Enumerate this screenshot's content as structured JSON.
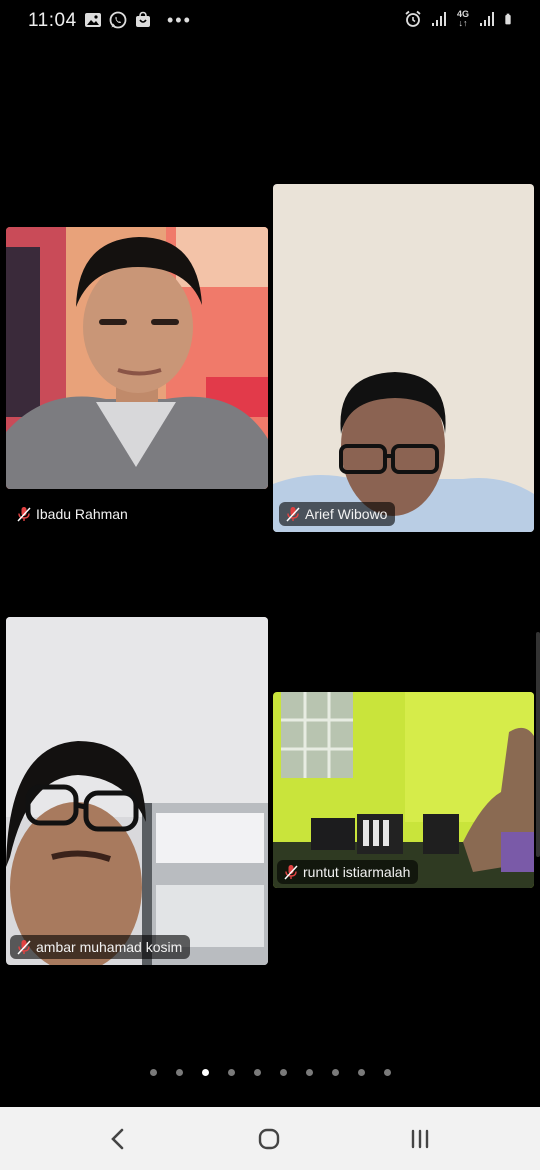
{
  "status_bar": {
    "time": "11:04",
    "network": "4G",
    "left_icons": [
      "gallery-icon",
      "whatsapp-icon",
      "shop-bag-icon",
      "more-dots-icon"
    ],
    "right_icons": [
      "alarm-icon",
      "signal-icon",
      "network-4g-icon",
      "signal-icon",
      "battery-icon"
    ]
  },
  "meeting": {
    "participants": [
      {
        "name": "Ibadu Rahman",
        "muted": true
      },
      {
        "name": "Arief Wibowo",
        "muted": true
      },
      {
        "name": "ambar muhamad kosim",
        "muted": true
      },
      {
        "name": "runtut istiarmalah",
        "muted": true
      }
    ],
    "pagination": {
      "total": 10,
      "current": 3
    }
  },
  "nav_bar": {
    "buttons": [
      "back-icon",
      "home-icon",
      "recents-icon"
    ]
  },
  "colors": {
    "background": "#000000",
    "nav_bar": "#f2f2f2",
    "dot_active": "#ffffff",
    "dot_inactive": "#7a7a7a"
  }
}
